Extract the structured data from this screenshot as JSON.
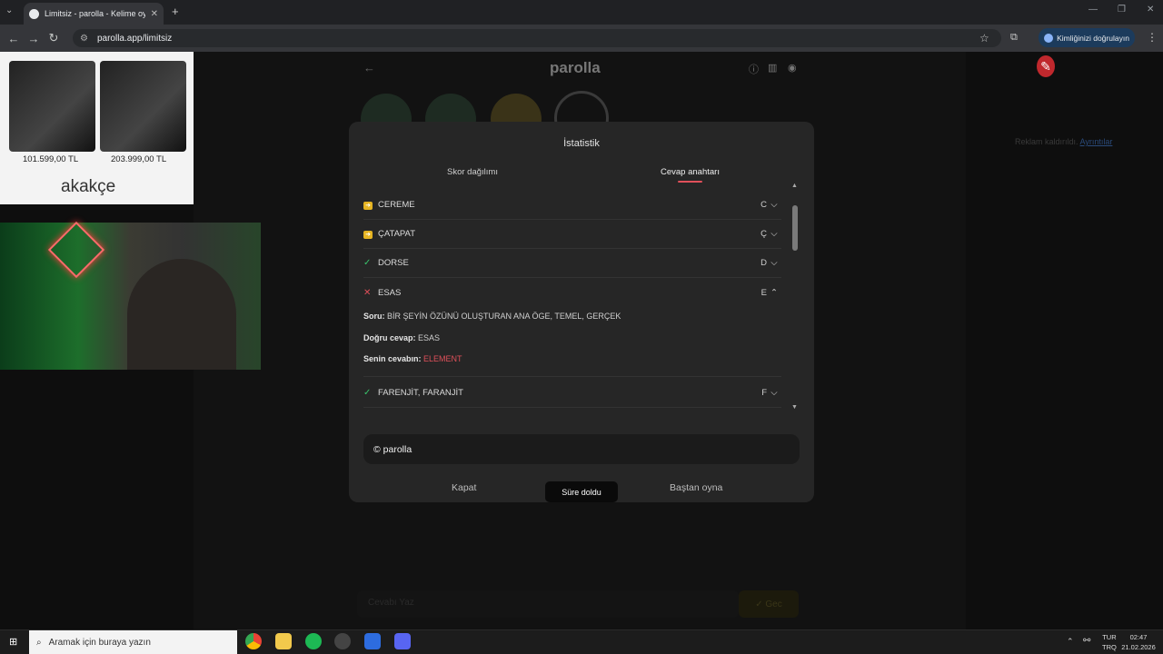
{
  "browser": {
    "tab_title": "Limitsiz - parolla - Kelime oyunu",
    "url": "parolla.app/limitsiz",
    "verify_label": "Kimliğinizi doğrulayın"
  },
  "ad": {
    "price1": "101.599,00 TL",
    "price2": "203.999,00 TL",
    "brand": "akakçe"
  },
  "game": {
    "logo": "parolla",
    "ad_notice": "Reklam kaldırıldı.",
    "ad_link": "Ayrıntılar",
    "answer_placeholder": "Cevabı Yaz",
    "submit_label": "✓ Gec"
  },
  "modal": {
    "title": "İstatistik",
    "tabs": [
      "Skor dağılımı",
      "Cevap anahtarı"
    ],
    "rows": [
      {
        "icon": "pass-icon",
        "word": "CEREME",
        "letter": "C",
        "chev": "⌵"
      },
      {
        "icon": "pass-icon",
        "word": "ÇATAPAT",
        "letter": "Ç",
        "chev": "⌵"
      },
      {
        "icon": "check-icon",
        "word": "DORSE",
        "letter": "D",
        "chev": "⌵"
      },
      {
        "icon": "cross-icon",
        "word": "ESAS",
        "letter": "E",
        "chev": "⌃"
      },
      {
        "icon": "check-icon",
        "word": "FARENJİT, FARANJİT",
        "letter": "F",
        "chev": "⌵"
      }
    ],
    "detail": {
      "q_label": "Soru:",
      "q_text": "BİR ŞEYİN ÖZÜNÜ OLUŞTURAN ANA ÖGE, TEMEL, GERÇEK",
      "correct_label": "Doğru cevap:",
      "correct_text": "ESAS",
      "yours_label": "Senin cevabın:",
      "yours_text": "ELEMENT"
    },
    "copyright": "© parolla",
    "close_label": "Kapat",
    "restart_label": "Baştan oyna",
    "toast": "Süre doldu",
    "colors": {
      "accent": "#e0505a",
      "pass": "#e6b422",
      "correct": "#39c26b",
      "wrong": "#e0505a"
    }
  },
  "taskbar": {
    "search_placeholder": "Aramak için buraya yazın",
    "lang1": "TUR",
    "lang2": "TRQ",
    "time": "02:47",
    "date": "21.02.2026"
  }
}
